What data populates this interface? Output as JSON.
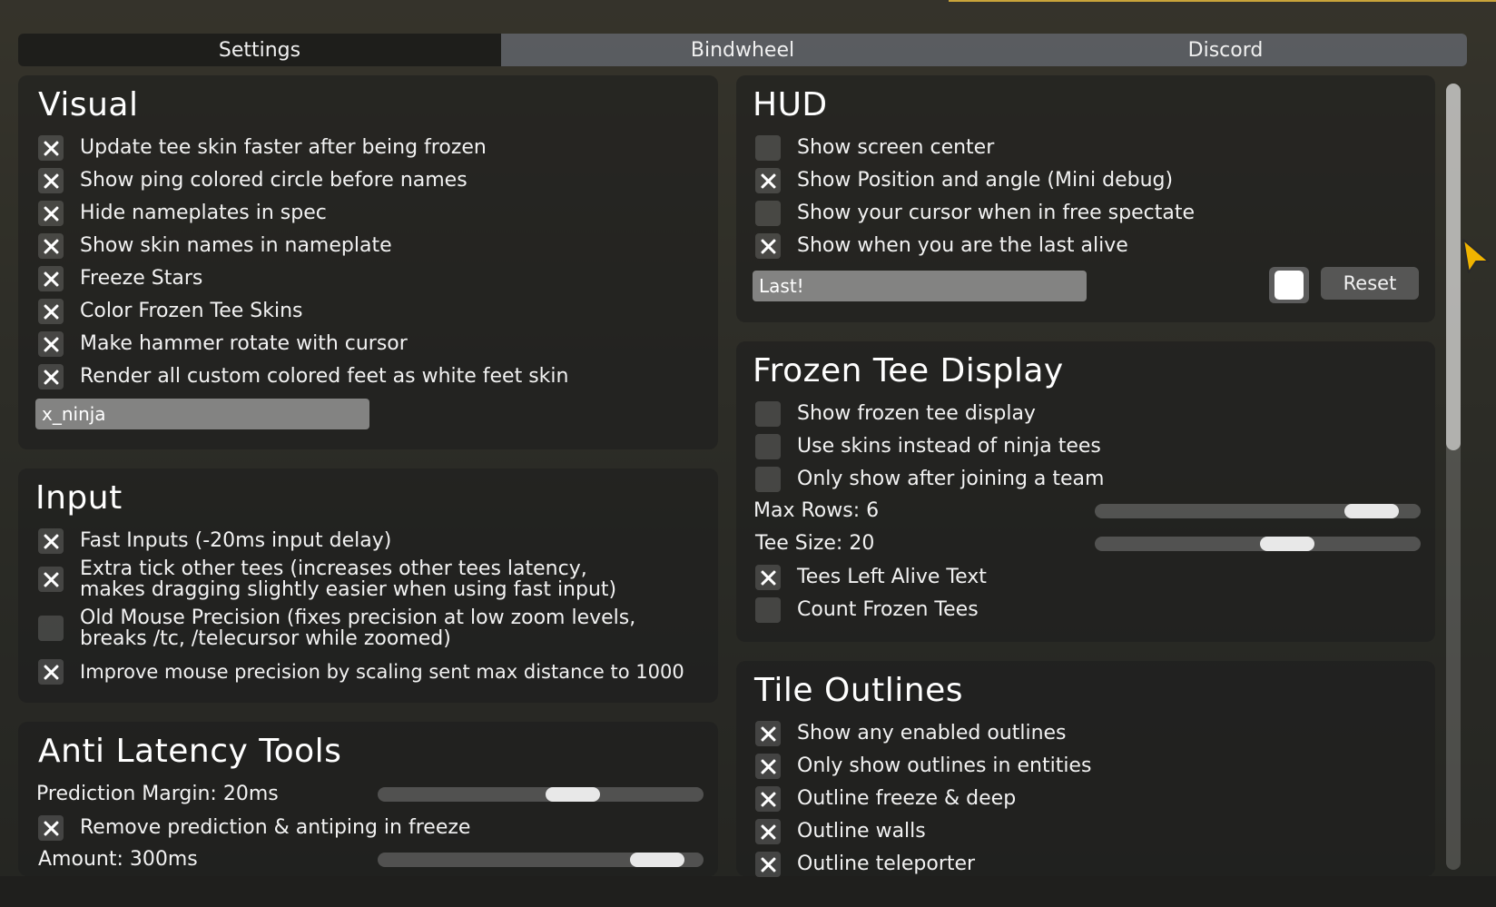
{
  "tabs": [
    "Settings",
    "Bindwheel",
    "Discord"
  ],
  "visual": {
    "title": "Visual",
    "options": [
      {
        "label": "Update tee skin faster after being frozen",
        "checked": true
      },
      {
        "label": "Show ping colored circle before names",
        "checked": true
      },
      {
        "label": "Hide nameplates in spec",
        "checked": true
      },
      {
        "label": "Show skin names in nameplate",
        "checked": true
      },
      {
        "label": "Freeze Stars",
        "checked": true
      },
      {
        "label": "Color Frozen Tee Skins",
        "checked": true
      },
      {
        "label": "Make hammer rotate with cursor",
        "checked": true
      },
      {
        "label": "Render all custom colored feet as white feet skin",
        "checked": true
      }
    ],
    "skin_input": "x_ninja"
  },
  "input": {
    "title": "Input",
    "fast_inputs": {
      "label": "Fast Inputs (-20ms input delay)",
      "checked": true
    },
    "extra_tick": {
      "line1": "Extra tick other tees (increases other tees latency,",
      "line2": "makes dragging slightly easier when using fast input)",
      "checked": true
    },
    "old_mouse": {
      "line1": "Old Mouse Precision (fixes precision at low zoom levels,",
      "line2": "breaks /tc, /telecursor while zoomed)",
      "checked": false
    },
    "improve_mouse": {
      "label": "Improve mouse precision by scaling sent max distance to 1000",
      "checked": true
    }
  },
  "anti_latency": {
    "title": "Anti Latency Tools",
    "prediction_margin_label": "Prediction Margin: 20ms",
    "prediction_margin_fraction": 0.62,
    "remove_prediction": {
      "label": "Remove prediction & antiping in freeze",
      "checked": true
    },
    "amount_label": "Amount: 300ms",
    "amount_fraction": 0.93
  },
  "hud": {
    "title": "HUD",
    "options": [
      {
        "label": "Show screen center",
        "checked": false
      },
      {
        "label": "Show Position and angle (Mini debug)",
        "checked": true
      },
      {
        "label": "Show your cursor when in free spectate",
        "checked": false
      },
      {
        "label": "Show when you are the last alive",
        "checked": true
      }
    ],
    "last_alive_text": "Last!",
    "reset_label": "Reset",
    "color_swatch": "#ffffff"
  },
  "frozen_tee": {
    "title": "Frozen Tee Display",
    "options": [
      {
        "label": "Show frozen tee display",
        "checked": false
      },
      {
        "label": "Use skins instead of ninja tees",
        "checked": false
      },
      {
        "label": "Only show after joining a team",
        "checked": false
      }
    ],
    "max_rows_label": "Max Rows: 6",
    "max_rows_fraction": 0.92,
    "tee_size_label": "Tee Size: 20",
    "tee_size_fraction": 0.61,
    "after_options": [
      {
        "label": "Tees Left Alive Text",
        "checked": true
      },
      {
        "label": "Count Frozen Tees",
        "checked": false
      }
    ]
  },
  "tile_outlines": {
    "title": "Tile Outlines",
    "options": [
      {
        "label": "Show any enabled outlines",
        "checked": true
      },
      {
        "label": "Only show outlines in entities",
        "checked": true
      },
      {
        "label": "Outline freeze & deep",
        "checked": true
      },
      {
        "label": "Outline walls",
        "checked": true
      },
      {
        "label": "Outline teleporter",
        "checked": true
      }
    ]
  },
  "scroll_fraction": 0.0
}
